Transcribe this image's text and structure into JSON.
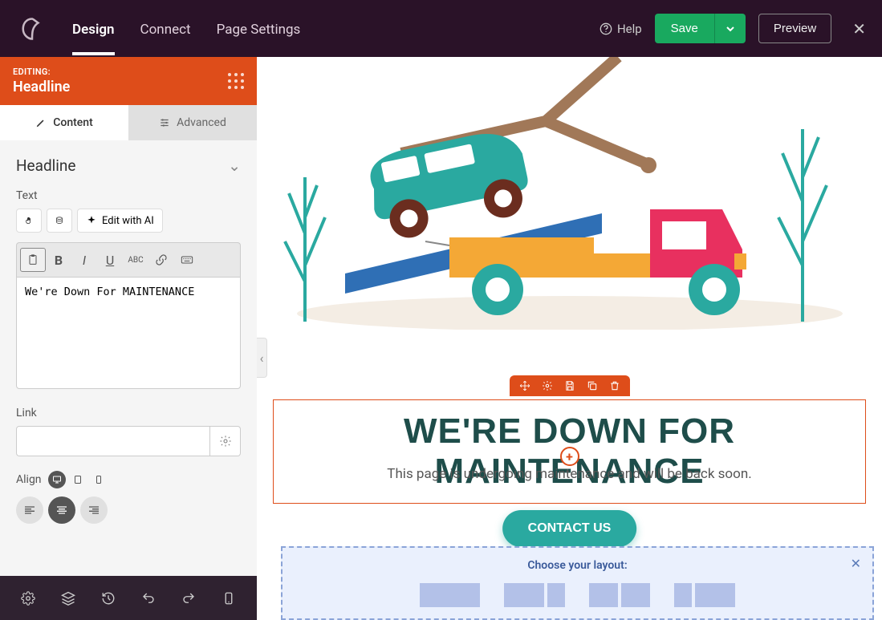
{
  "topbar": {
    "tabs": [
      "Design",
      "Connect",
      "Page Settings"
    ],
    "help": "Help",
    "save": "Save",
    "preview": "Preview"
  },
  "sidebar": {
    "editing_label": "EDITING:",
    "editing_title": "Headline",
    "sub_tabs": {
      "content": "Content",
      "advanced": "Advanced"
    },
    "section": "Headline",
    "text_label": "Text",
    "edit_ai": "Edit with AI",
    "textarea_value": "We're Down For MAINTENANCE",
    "link_label": "Link",
    "link_value": "",
    "align_label": "Align"
  },
  "canvas": {
    "headline": "WE'RE DOWN FOR MAINTENANCE",
    "subtitle": "This page is undergoing maintenance and will be back soon.",
    "cta": "CONTACT US",
    "layout_title": "Choose your layout:"
  },
  "colors": {
    "accent": "#de4d1a",
    "teal": "#2aa9a0",
    "save": "#19a95f",
    "headline": "#1e4d4a"
  }
}
